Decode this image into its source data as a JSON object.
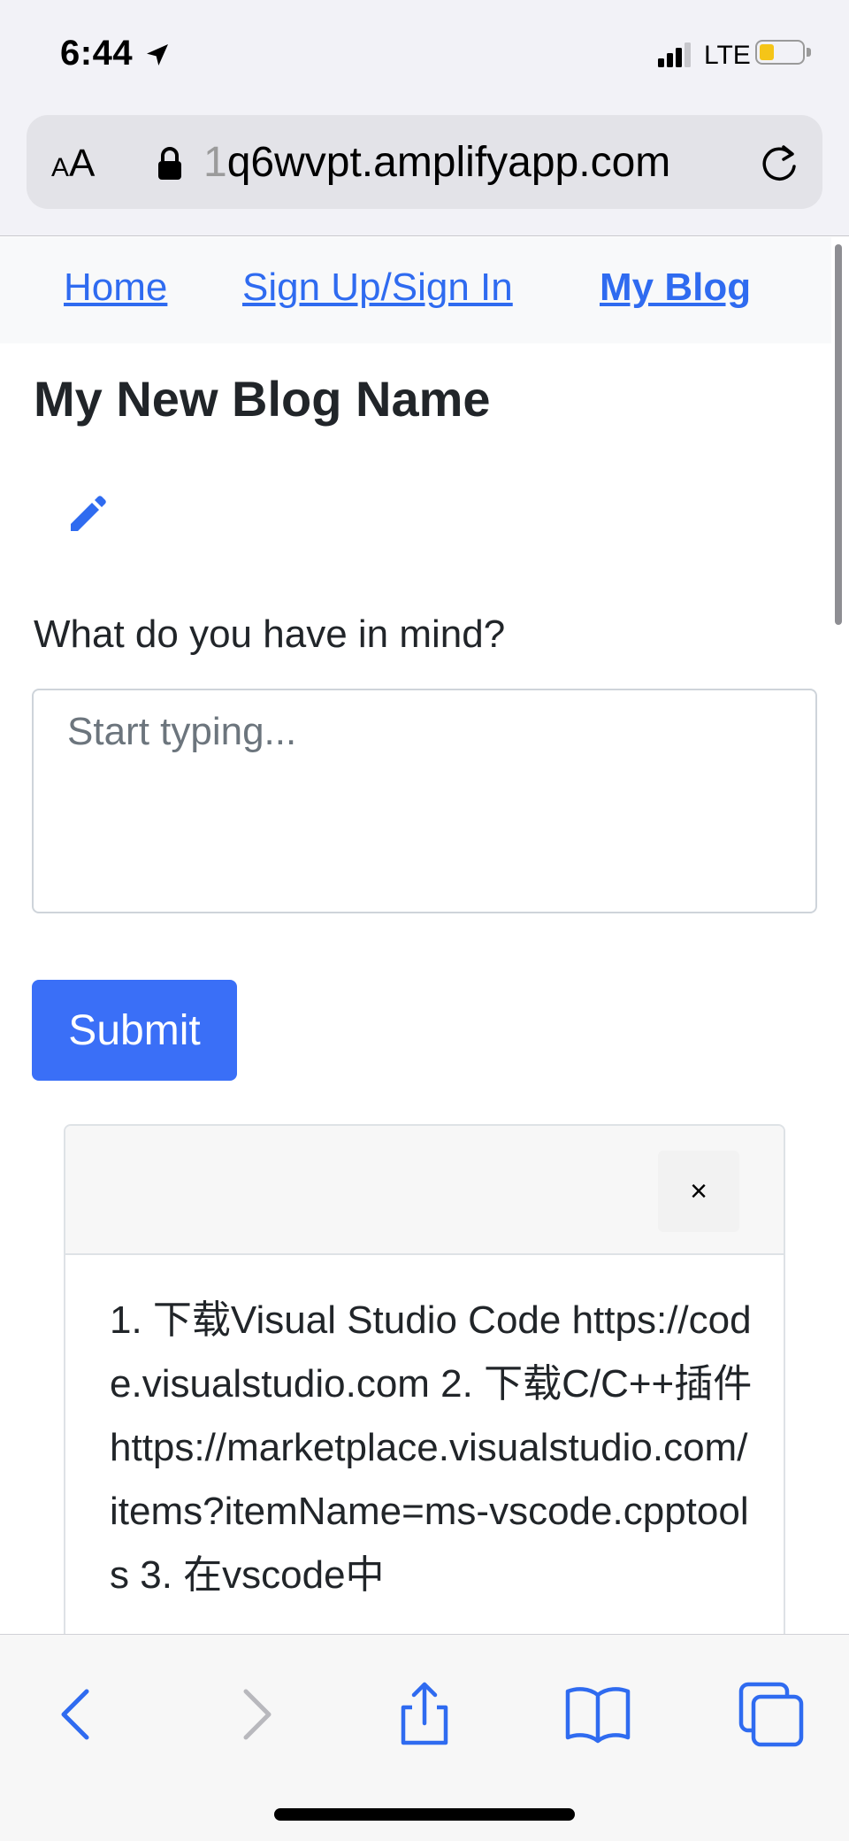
{
  "status_bar": {
    "time": "6:44",
    "network": "LTE"
  },
  "browser": {
    "text_size_label": "AA",
    "url_dim": "1",
    "url_main": "q6wvpt.amplifyapp.com"
  },
  "nav": {
    "items": [
      {
        "label": "Home"
      },
      {
        "label": "Sign Up/Sign In"
      },
      {
        "label": "My Blog"
      }
    ]
  },
  "main": {
    "title": "My New Blog Name",
    "prompt_label": "What do you have in mind?",
    "input_placeholder": "Start typing...",
    "submit_label": "Submit"
  },
  "post": {
    "close_label": "×",
    "body": " 1. 下载Visual Studio Code https://code.visualstudio.com 2. 下载C/C++插件 https://marketplace.visualstudio.com/items?itemName=ms-vscode.cpptools 3. 在vscode中"
  },
  "colors": {
    "accent": "#3a6ff7",
    "link": "#2f6bf0",
    "nav_bg": "#f8f9fa"
  },
  "icons": {
    "edit": "pencil-icon",
    "back": "chevron-left-icon",
    "forward": "chevron-right-icon",
    "share": "share-icon",
    "bookmarks": "book-icon",
    "tabs": "tabs-icon"
  }
}
